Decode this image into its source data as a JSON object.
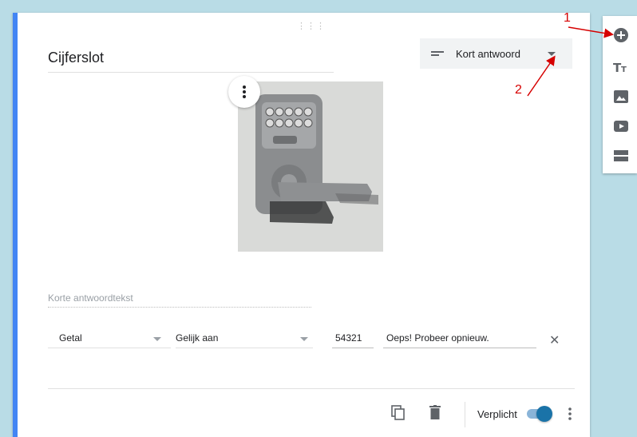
{
  "question": {
    "title": "Cijferslot",
    "type_label": "Kort antwoord",
    "short_answer_placeholder": "Korte antwoordtekst"
  },
  "validation": {
    "type": "Getal",
    "condition": "Gelijk aan",
    "value": "54321",
    "error_text": "Oeps! Probeer opnieuw."
  },
  "footer": {
    "required_label": "Verplicht",
    "required": true
  },
  "annotations": {
    "first": "1",
    "second": "2"
  },
  "colors": {
    "accent": "#4285f4",
    "background": "#b9dce6",
    "annotation": "#d60000"
  }
}
